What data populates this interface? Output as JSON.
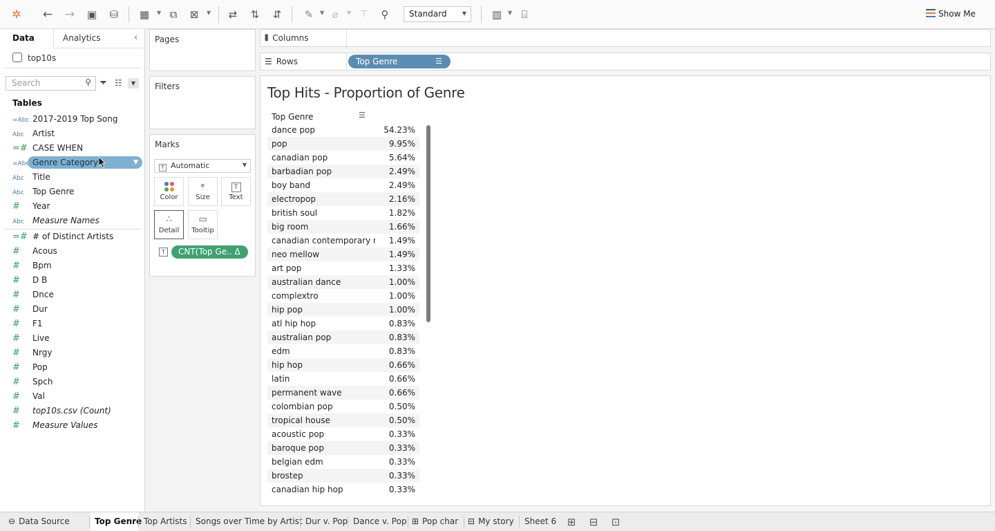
{
  "toolbar": {
    "fit_select": "Standard",
    "show_me": "Show Me"
  },
  "data_pane": {
    "tabs": [
      "Data",
      "Analytics"
    ],
    "datasource": "top10s",
    "search_placeholder": "Search",
    "tables_heading": "Tables",
    "fields": [
      {
        "icon": "=Abc",
        "label": "2017-2019 Top Song",
        "kind": "dim"
      },
      {
        "icon": "Abc",
        "label": "Artist",
        "kind": "dim"
      },
      {
        "icon": "=#",
        "label": "CASE WHEN",
        "kind": "dim"
      },
      {
        "icon": "=Abc",
        "label": "Genre Category",
        "kind": "dim",
        "selected": true
      },
      {
        "icon": "Abc",
        "label": "Title",
        "kind": "dim"
      },
      {
        "icon": "Abc",
        "label": "Top Genre",
        "kind": "dim"
      },
      {
        "icon": "#",
        "label": "Year",
        "kind": "dim"
      },
      {
        "icon": "Abc",
        "label": "Measure Names",
        "kind": "dim",
        "italic": true
      },
      {
        "icon": "=#",
        "label": "# of Distinct Artists",
        "kind": "measure"
      },
      {
        "icon": "#",
        "label": "Acous",
        "kind": "measure"
      },
      {
        "icon": "#",
        "label": "Bpm",
        "kind": "measure"
      },
      {
        "icon": "#",
        "label": "D B",
        "kind": "measure"
      },
      {
        "icon": "#",
        "label": "Dnce",
        "kind": "measure"
      },
      {
        "icon": "#",
        "label": "Dur",
        "kind": "measure"
      },
      {
        "icon": "#",
        "label": "F1",
        "kind": "measure"
      },
      {
        "icon": "#",
        "label": "Live",
        "kind": "measure"
      },
      {
        "icon": "#",
        "label": "Nrgy",
        "kind": "measure"
      },
      {
        "icon": "#",
        "label": "Pop",
        "kind": "measure"
      },
      {
        "icon": "#",
        "label": "Spch",
        "kind": "measure"
      },
      {
        "icon": "#",
        "label": "Val",
        "kind": "measure"
      },
      {
        "icon": "#",
        "label": "top10s.csv (Count)",
        "kind": "measure",
        "italic": true
      },
      {
        "icon": "#",
        "label": "Measure Values",
        "kind": "measure",
        "italic": true
      }
    ]
  },
  "shelves": {
    "pages": "Pages",
    "filters": "Filters",
    "marks": "Marks",
    "mark_type": "Automatic",
    "mark_buttons": [
      "Color",
      "Size",
      "Text",
      "Detail",
      "Tooltip"
    ],
    "mark_pill": "CNT(Top Ge.. Δ",
    "columns": "Columns",
    "rows": "Rows",
    "rows_pill": "Top Genre"
  },
  "view": {
    "title": "Top Hits - Proportion of Genre",
    "column_header": "Top Genre",
    "rows": [
      {
        "genre": "dance pop",
        "pct": "54.23%"
      },
      {
        "genre": "pop",
        "pct": "9.95%"
      },
      {
        "genre": "canadian pop",
        "pct": "5.64%"
      },
      {
        "genre": "barbadian pop",
        "pct": "2.49%"
      },
      {
        "genre": "boy band",
        "pct": "2.49%"
      },
      {
        "genre": "electropop",
        "pct": "2.16%"
      },
      {
        "genre": "british soul",
        "pct": "1.82%"
      },
      {
        "genre": "big room",
        "pct": "1.66%"
      },
      {
        "genre": "canadian contemporary r..",
        "pct": "1.49%"
      },
      {
        "genre": "neo mellow",
        "pct": "1.49%"
      },
      {
        "genre": "art pop",
        "pct": "1.33%"
      },
      {
        "genre": "australian dance",
        "pct": "1.00%"
      },
      {
        "genre": "complextro",
        "pct": "1.00%"
      },
      {
        "genre": "hip pop",
        "pct": "1.00%"
      },
      {
        "genre": "atl hip hop",
        "pct": "0.83%"
      },
      {
        "genre": "australian pop",
        "pct": "0.83%"
      },
      {
        "genre": "edm",
        "pct": "0.83%"
      },
      {
        "genre": "hip hop",
        "pct": "0.66%"
      },
      {
        "genre": "latin",
        "pct": "0.66%"
      },
      {
        "genre": "permanent wave",
        "pct": "0.66%"
      },
      {
        "genre": "colombian pop",
        "pct": "0.50%"
      },
      {
        "genre": "tropical house",
        "pct": "0.50%"
      },
      {
        "genre": "acoustic pop",
        "pct": "0.33%"
      },
      {
        "genre": "baroque pop",
        "pct": "0.33%"
      },
      {
        "genre": "belgian edm",
        "pct": "0.33%"
      },
      {
        "genre": "brostep",
        "pct": "0.33%"
      },
      {
        "genre": "canadian hip hop",
        "pct": "0.33%"
      }
    ]
  },
  "sheet_tabs": [
    {
      "label": "Data Source",
      "icon": "datasource-icon"
    },
    {
      "label": "Top Genre",
      "active": true
    },
    {
      "label": "Top Artists"
    },
    {
      "label": "Songs over Time by Artist"
    },
    {
      "label": "Dur v. Pop"
    },
    {
      "label": "Dance v. Pop"
    },
    {
      "label": "Pop char",
      "icon": "dashboard-icon"
    },
    {
      "label": "My story",
      "icon": "story-icon"
    },
    {
      "label": "Sheet 6"
    }
  ],
  "colors": {
    "selected_field_pill": "#7fb0cf",
    "rows_pill": "#5b8db3",
    "marks_pill": "#40a071",
    "measure_icon": "#3a9a6c",
    "dimension_icon": "#4e79a7"
  }
}
